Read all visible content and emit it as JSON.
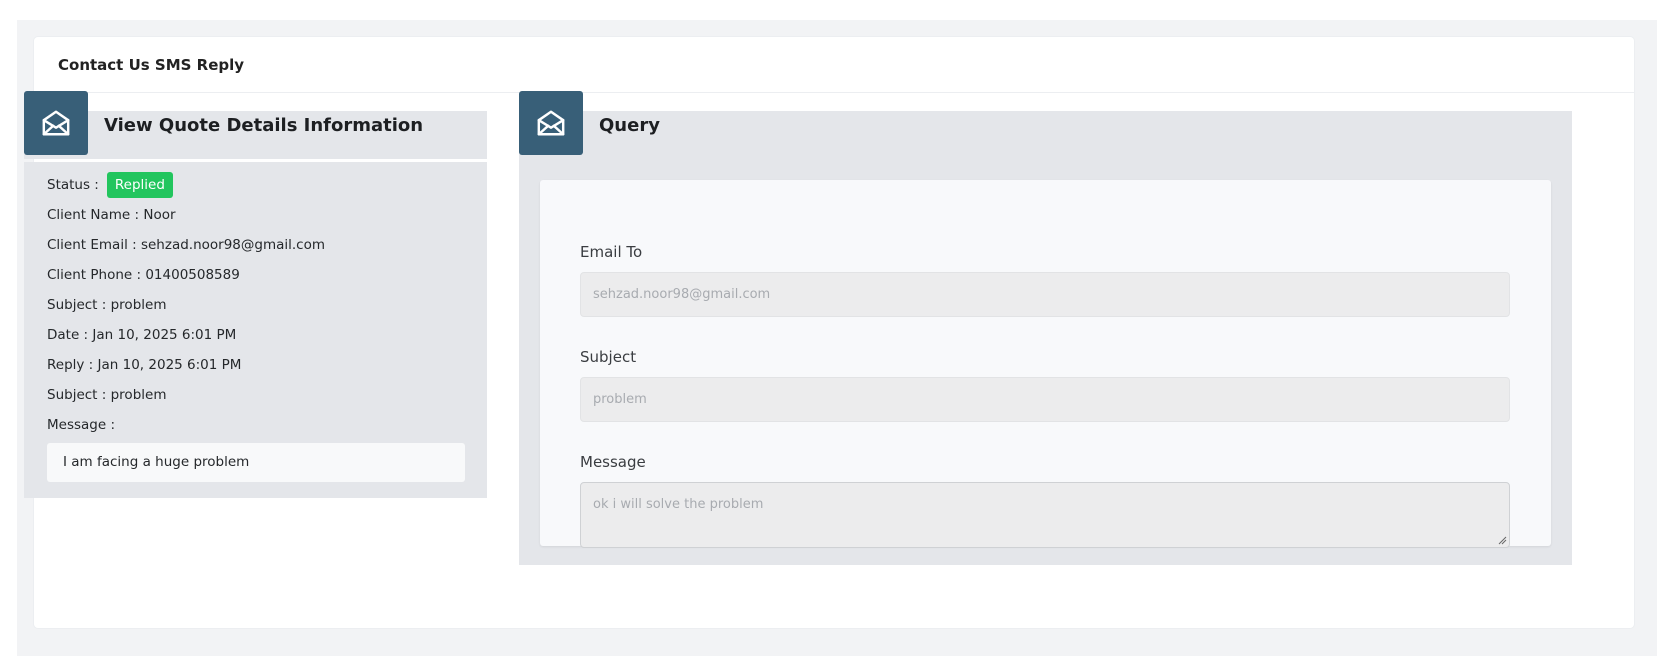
{
  "card": {
    "title": "Contact Us SMS Reply"
  },
  "left_panel": {
    "icon": "envelope-open-icon",
    "title": "View Quote Details Information",
    "status_label": "Status :",
    "status_badge": "Replied",
    "status_color": "#22c55e",
    "rows": [
      {
        "label": "Client Name :",
        "value": "Noor"
      },
      {
        "label": "Client Email :",
        "value": "sehzad.noor98@gmail.com"
      },
      {
        "label": "Client Phone :",
        "value": "01400508589"
      },
      {
        "label": "Subject :",
        "value": "problem"
      },
      {
        "label": "Date :",
        "value": "Jan 10, 2025 6:01 PM"
      },
      {
        "label": "Reply :",
        "value": "Jan 10, 2025 6:01 PM"
      },
      {
        "label": "Subject :",
        "value": "problem"
      }
    ],
    "message_label": "Message :",
    "message_text": "I am facing a huge problem"
  },
  "right_panel": {
    "icon": "envelope-open-icon",
    "title": "Query",
    "fields": {
      "email": {
        "label": "Email To",
        "value": "sehzad.noor98@gmail.com"
      },
      "subject": {
        "label": "Subject",
        "value": "problem"
      },
      "message": {
        "label": "Message",
        "value": "ok i will solve the problem"
      }
    }
  },
  "colors": {
    "icon_bg": "#385f78",
    "panel_bg": "#e4e6ea",
    "badge_success": "#22c55e"
  }
}
